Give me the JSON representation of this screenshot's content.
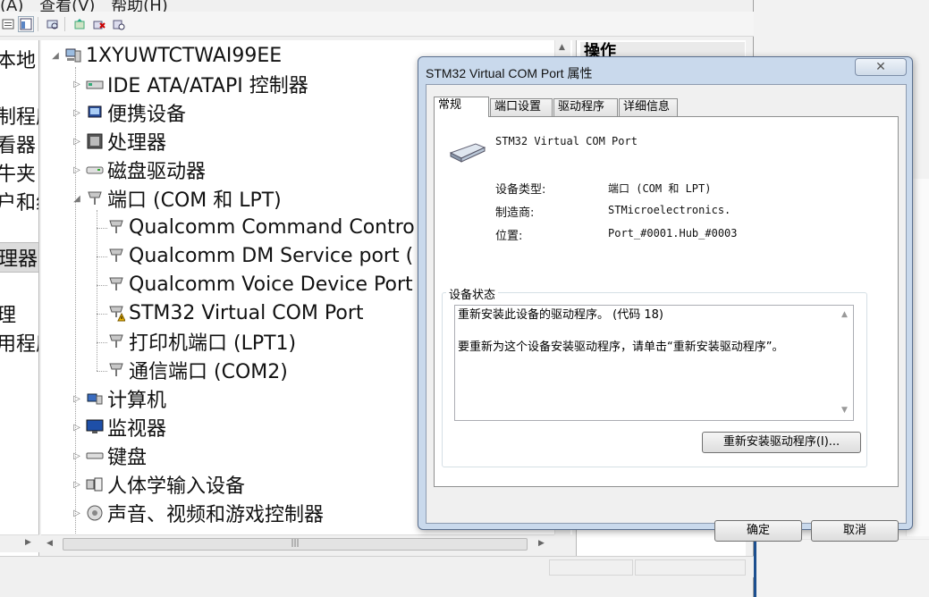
{
  "menu": {
    "action": "(A)",
    "view": "查看(V)",
    "help": "帮助(H)"
  },
  "left_pane": {
    "items": [
      "本地",
      "制程序",
      "看器",
      "牛夹",
      "户和组",
      "理器",
      "理",
      "用程序"
    ]
  },
  "tree": {
    "root": "1XYUWTCTWAI99EE",
    "categories": [
      {
        "label": "IDE ATA/ATAPI 控制器",
        "icon": "ide-controller-icon"
      },
      {
        "label": "便携设备",
        "icon": "portable-device-icon"
      },
      {
        "label": "处理器",
        "icon": "processor-icon"
      },
      {
        "label": "磁盘驱动器",
        "icon": "disk-drive-icon"
      },
      {
        "label": "端口 (COM 和 LPT)",
        "icon": "port-icon"
      }
    ],
    "ports": [
      {
        "label": "Qualcomm Command Contro",
        "icon": "port-icon"
      },
      {
        "label": "Qualcomm DM Service port (",
        "icon": "port-icon"
      },
      {
        "label": "Qualcomm Voice Device Port",
        "icon": "port-icon"
      },
      {
        "label": "STM32 Virtual COM Port",
        "icon": "port-warning-icon"
      },
      {
        "label": "打印机端口 (LPT1)",
        "icon": "port-icon"
      },
      {
        "label": "通信端口 (COM2)",
        "icon": "port-icon"
      }
    ],
    "more": [
      {
        "label": "计算机",
        "icon": "computer-icon"
      },
      {
        "label": "监视器",
        "icon": "monitor-icon"
      },
      {
        "label": "键盘",
        "icon": "keyboard-icon"
      },
      {
        "label": "人体学输入设备",
        "icon": "hid-icon"
      },
      {
        "label": "声音、视频和游戏控制器",
        "icon": "sound-icon"
      }
    ]
  },
  "actions_pane": {
    "title": "操作"
  },
  "dialog": {
    "title": "STM32 Virtual COM Port  属性",
    "close_glyph": "✕",
    "tabs": [
      "常规",
      "端口设置",
      "驱动程序",
      "详细信息"
    ],
    "active_tab": "常规",
    "device_name": "STM32 Virtual COM Port",
    "fields": {
      "type_label": "设备类型:",
      "type_value": "端口 (COM 和 LPT)",
      "maker_label": "制造商:",
      "maker_value": "STMicroelectronics.",
      "location_label": "位置:",
      "location_value": "Port_#0001.Hub_#0003"
    },
    "status_group_title": "设备状态",
    "status_text": "重新安装此设备的驱动程序。 (代码 18)\n\n要重新为这个设备安装驱动程序，请单击“重新安装驱动程序”。",
    "reinstall_button": "重新安装驱动程序(I)...",
    "ok_button": "确定",
    "cancel_button": "取消"
  },
  "colors": {
    "dialog_frame": "#c9d9ec",
    "warning": "#e8b100",
    "accent_blue": "#1c4f8f"
  }
}
